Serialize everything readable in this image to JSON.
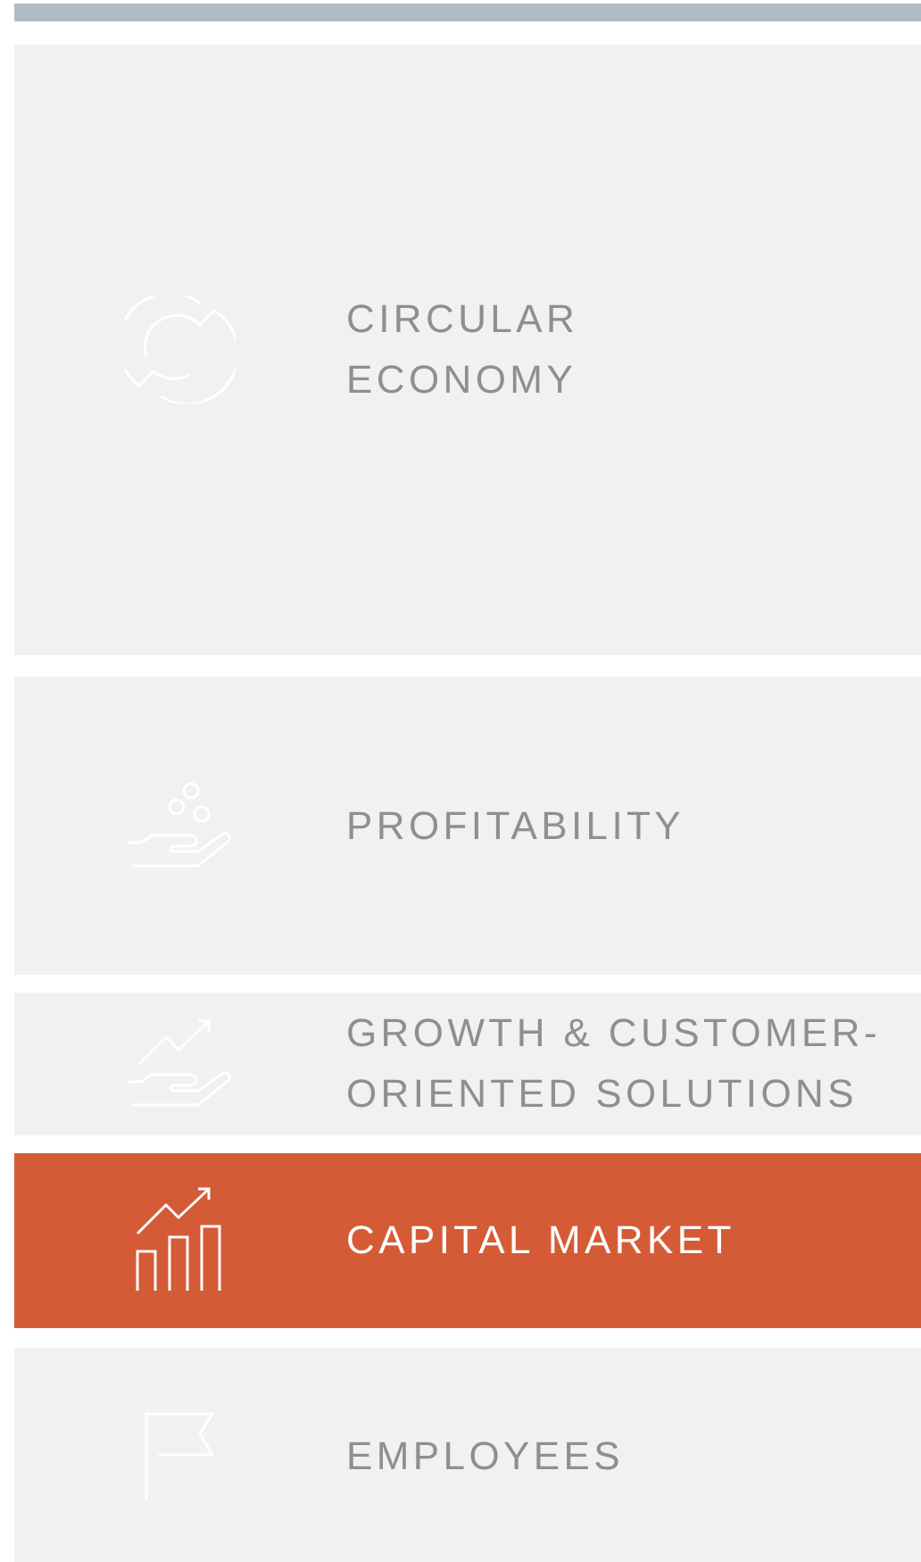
{
  "menu": [
    {
      "label": "CIRCULAR\nECONOMY",
      "selected": false
    },
    {
      "label": "PROFITABILITY",
      "selected": false
    },
    {
      "label": "GROWTH & CUSTOMER-\nORIENTED SOLUTIONS",
      "selected": false
    },
    {
      "label": "CAPITAL MARKET",
      "selected": true
    },
    {
      "label": "EMPLOYEES",
      "selected": false
    }
  ]
}
